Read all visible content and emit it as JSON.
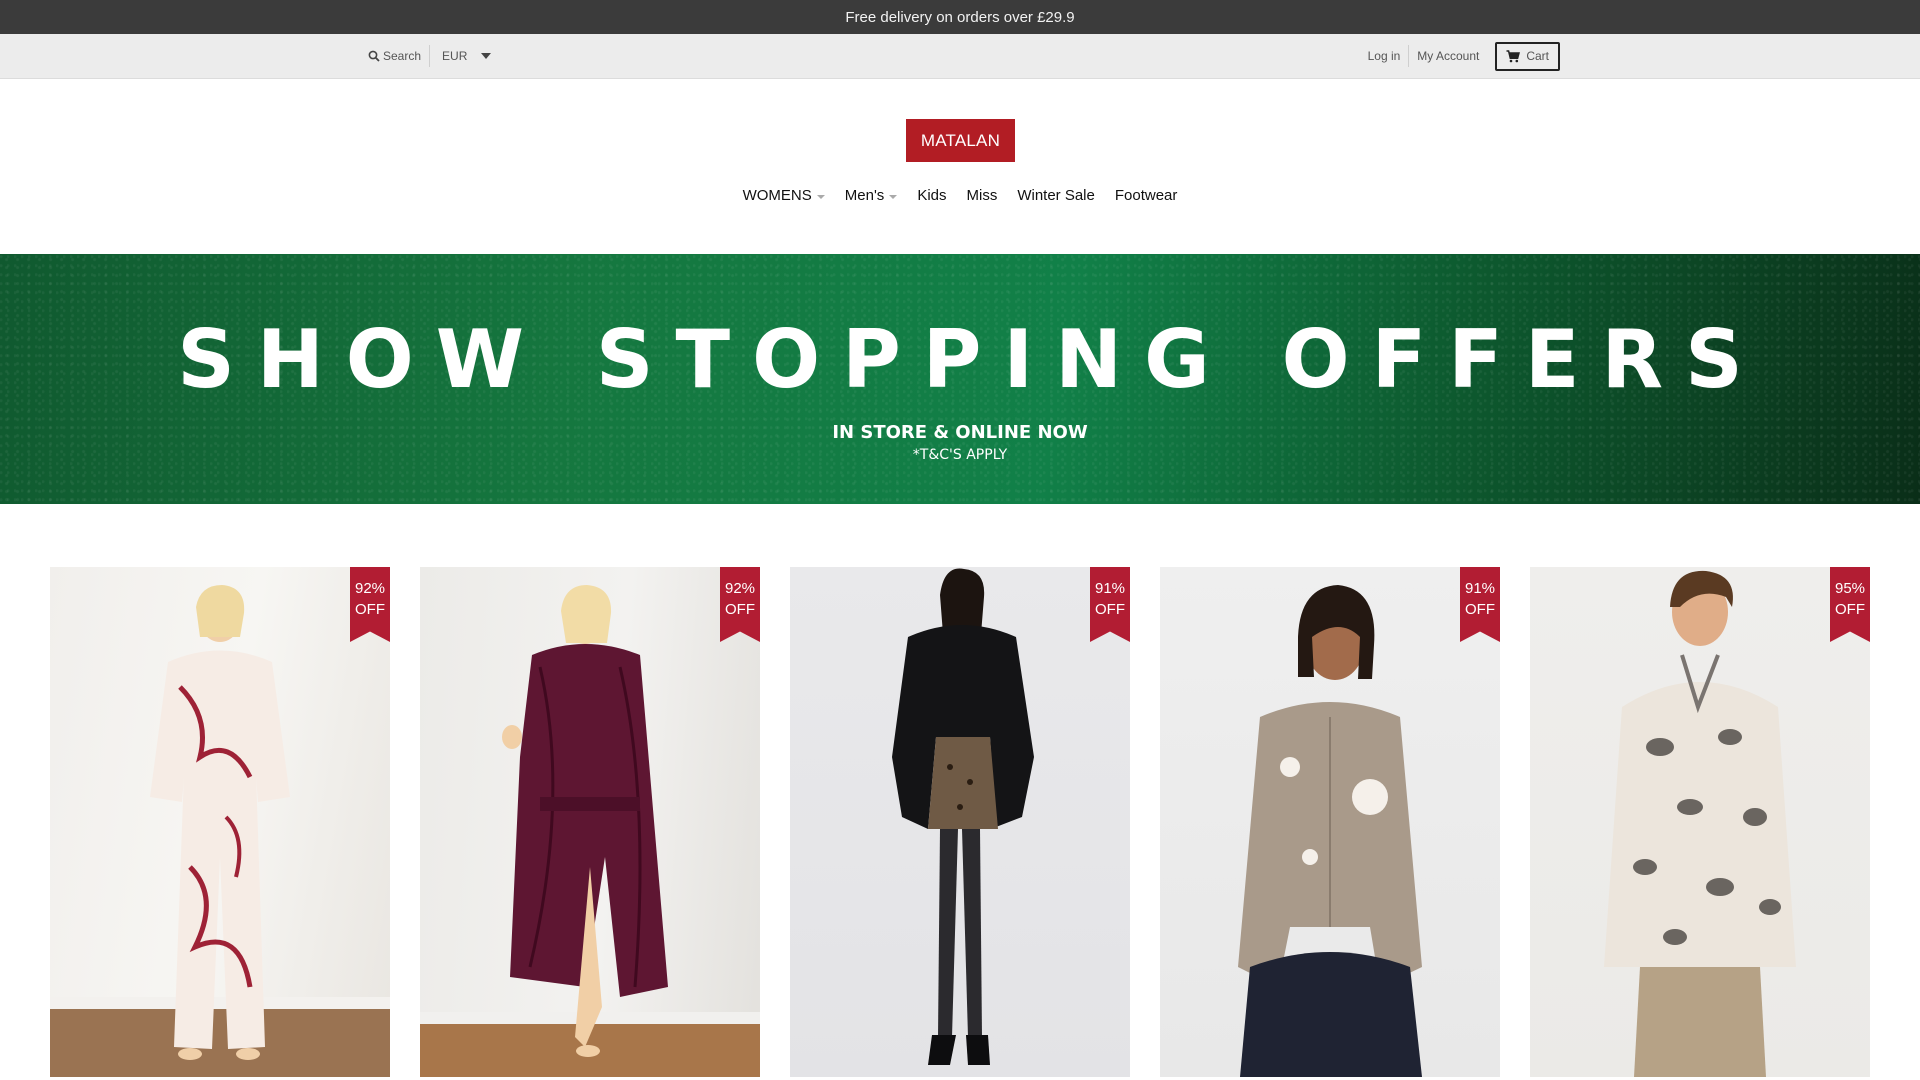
{
  "announcement": "Free delivery on orders over £29.9",
  "utility": {
    "search_label": "Search",
    "currency": "EUR",
    "login_label": "Log in",
    "account_label": "My Account",
    "cart_label": "Cart"
  },
  "logo": "MATALAN",
  "nav": [
    {
      "label": "WOMENS",
      "has_dropdown": true
    },
    {
      "label": "Men's",
      "has_dropdown": true
    },
    {
      "label": "Kids",
      "has_dropdown": false
    },
    {
      "label": "Miss",
      "has_dropdown": false
    },
    {
      "label": "Winter Sale",
      "has_dropdown": false
    },
    {
      "label": "Footwear",
      "has_dropdown": false
    }
  ],
  "hero": {
    "title": "SHOW STOPPING OFFERS",
    "subtitle": "IN STORE & ONLINE NOW",
    "terms": "*T&C'S APPLY"
  },
  "products": [
    {
      "discount_pct": "92%",
      "discount_word": "OFF",
      "image": "model in cream pyjamas with red bow print"
    },
    {
      "discount_pct": "92%",
      "discount_word": "OFF",
      "image": "model in plum faux fur dressing gown"
    },
    {
      "discount_pct": "91%",
      "discount_word": "OFF",
      "image": "model in black faux fur coat and sequin skirt"
    },
    {
      "discount_pct": "91%",
      "discount_word": "OFF",
      "image": "model in beige cardigan with flower appliqué"
    },
    {
      "discount_pct": "95%",
      "discount_word": "OFF",
      "image": "model in leopard print fleece half zip"
    }
  ],
  "colors": {
    "announce_bg": "#3b3b3b",
    "brand_red": "#b21d24",
    "badge_red": "#b21d33",
    "hero_green": "#15773f"
  }
}
